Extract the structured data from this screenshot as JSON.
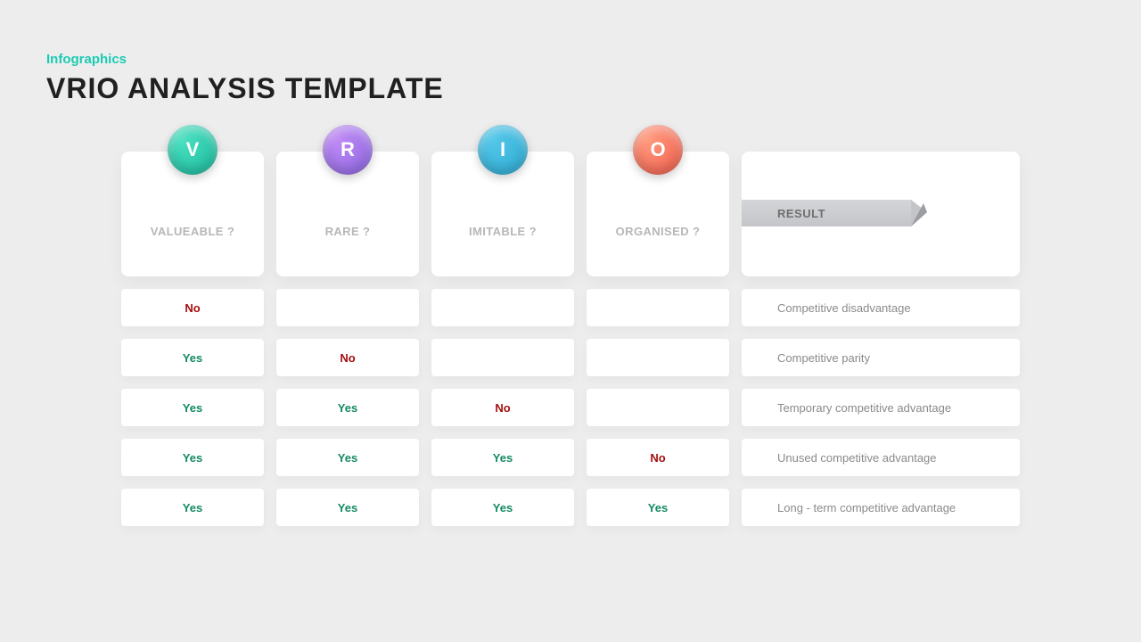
{
  "eyebrow": "Infographics",
  "title": "VRIO ANALYSIS TEMPLATE",
  "columns": [
    {
      "letter": "V",
      "label": "VALUEABLE ?"
    },
    {
      "letter": "R",
      "label": "RARE ?"
    },
    {
      "letter": "I",
      "label": "IMITABLE ?"
    },
    {
      "letter": "O",
      "label": "ORGANISED ?"
    }
  ],
  "result_label": "RESULT",
  "rows": [
    {
      "v": "No",
      "r": "",
      "i": "",
      "o": "",
      "result": "Competitive disadvantage"
    },
    {
      "v": "Yes",
      "r": "No",
      "i": "",
      "o": "",
      "result": "Competitive parity"
    },
    {
      "v": "Yes",
      "r": "Yes",
      "i": "No",
      "o": "",
      "result": "Temporary competitive advantage"
    },
    {
      "v": "Yes",
      "r": "Yes",
      "i": "Yes",
      "o": "No",
      "result": "Unused competitive advantage"
    },
    {
      "v": "Yes",
      "r": "Yes",
      "i": "Yes",
      "o": "Yes",
      "result": "Long - term competitive advantage"
    }
  ]
}
